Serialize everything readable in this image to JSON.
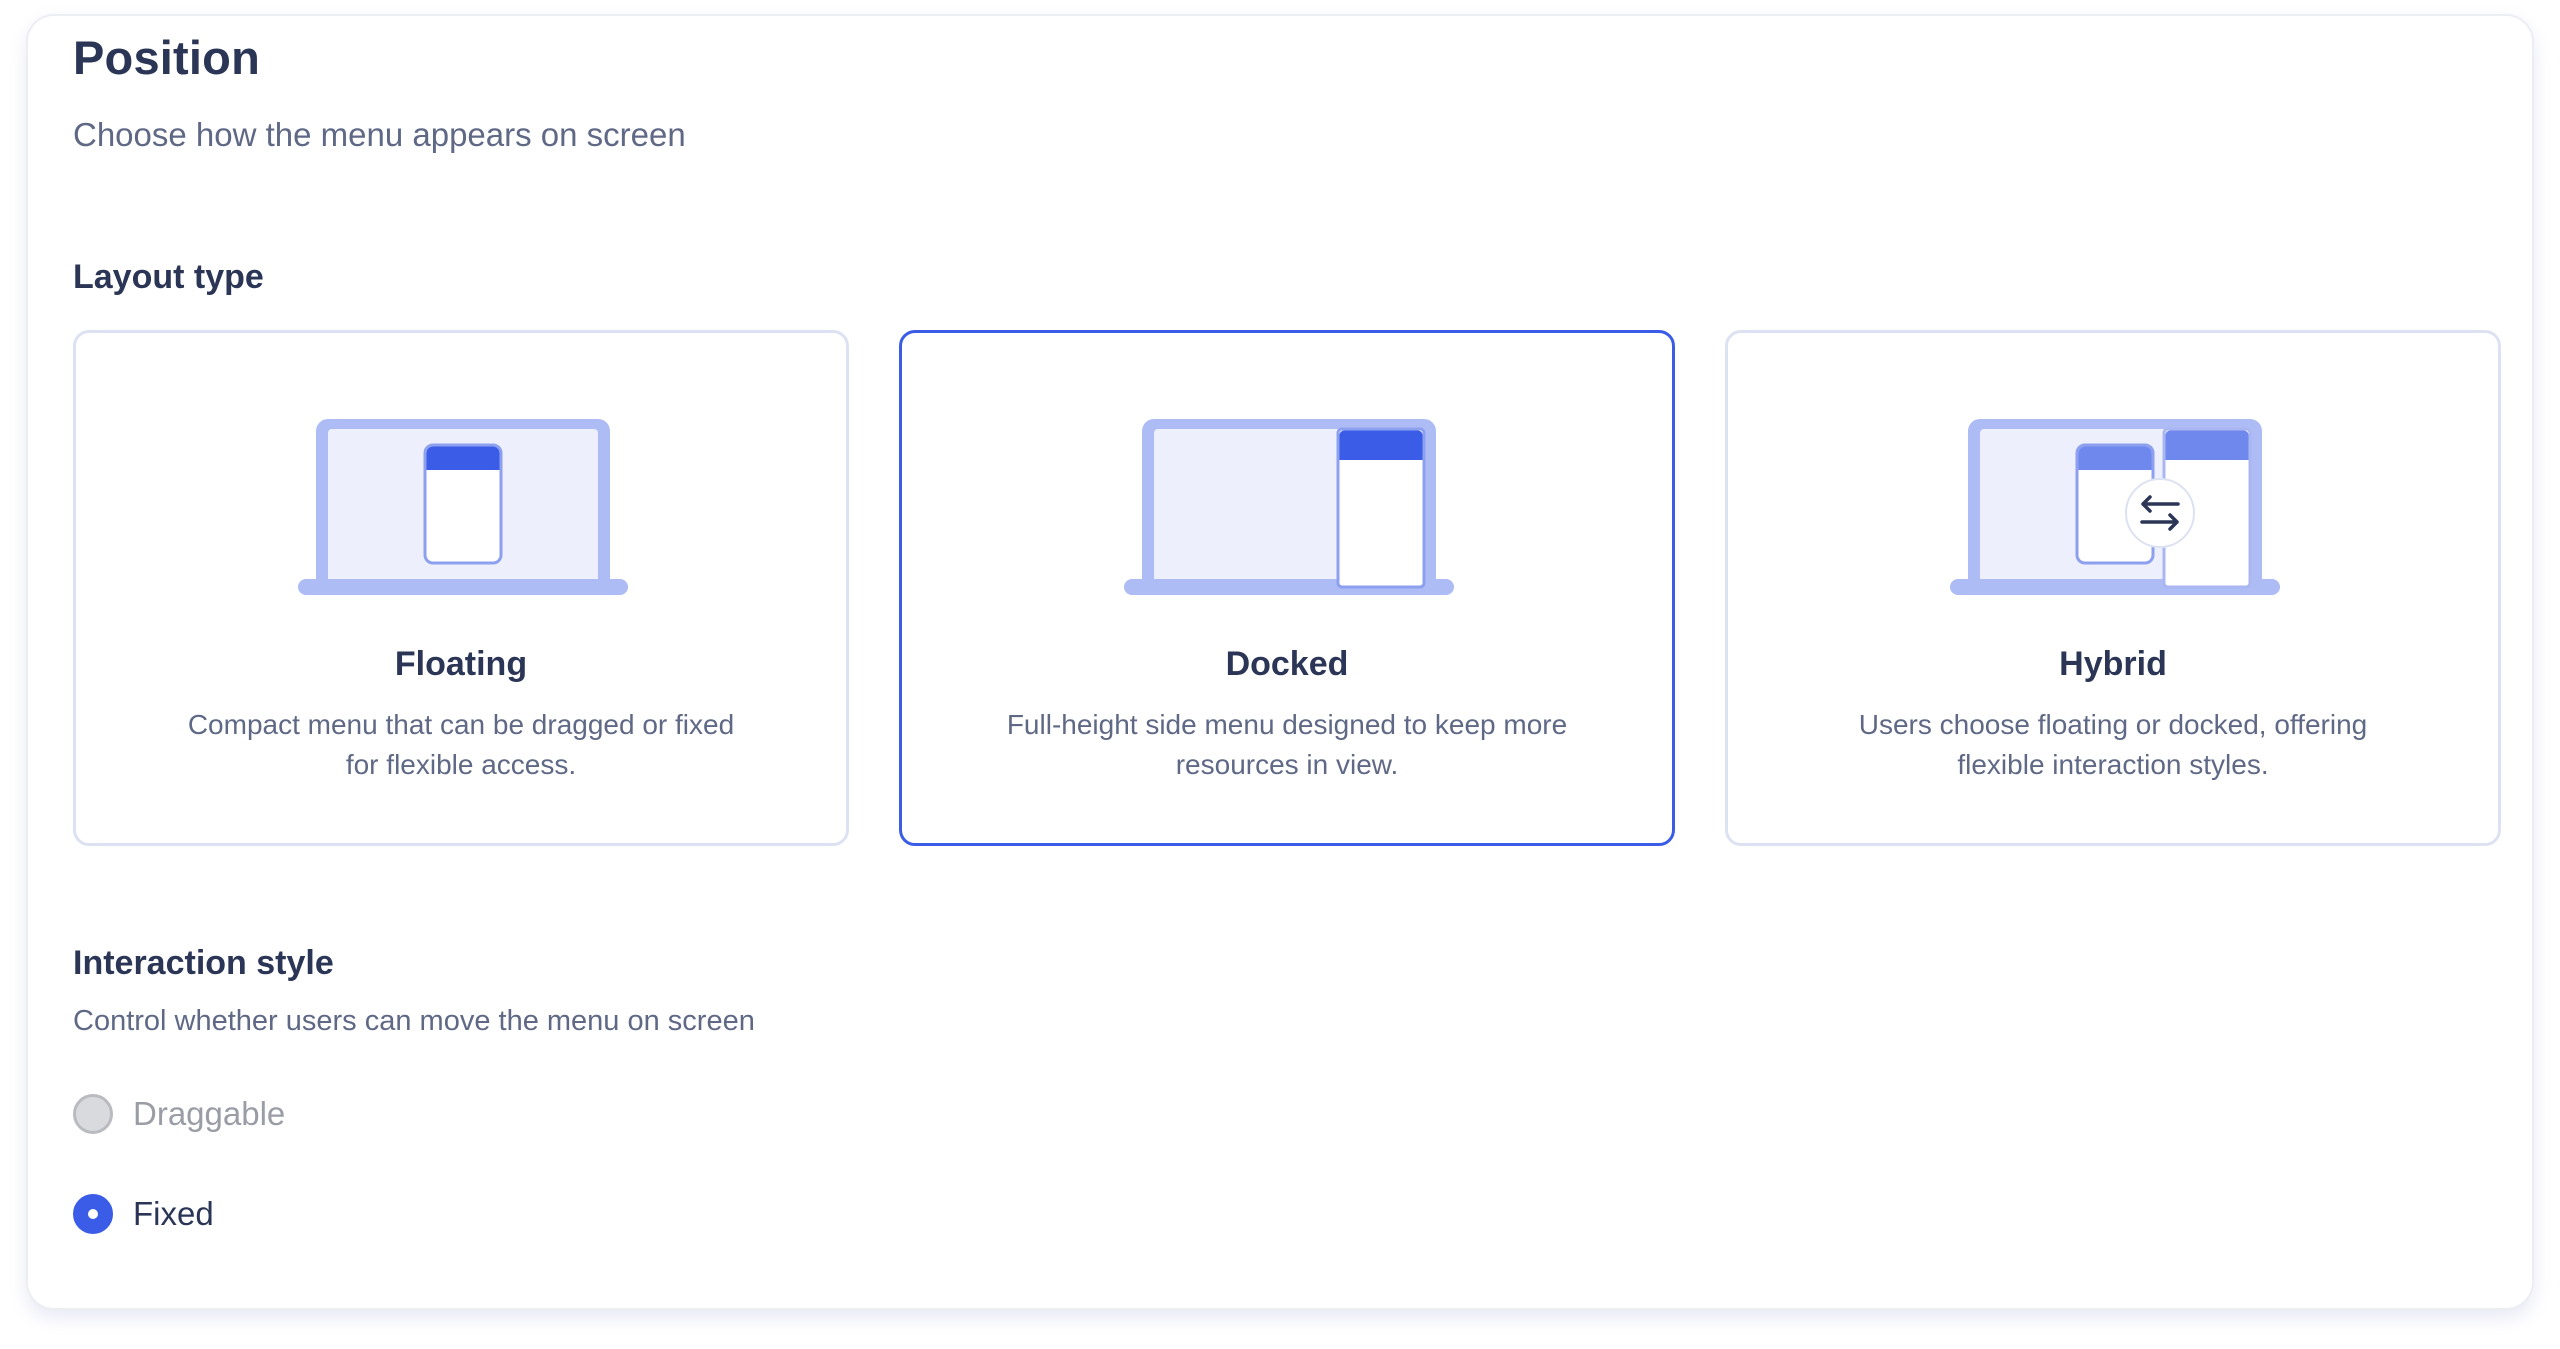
{
  "header": {
    "title": "Position",
    "subtitle": "Choose how the menu appears on screen"
  },
  "layout": {
    "label": "Layout type",
    "selected": "Docked",
    "options": [
      {
        "title": "Floating",
        "description": "Compact menu that can be dragged or fixed for flexible access.",
        "icon": "floating-layout-icon"
      },
      {
        "title": "Docked",
        "description": "Full-height side menu designed to keep more resources in view.",
        "icon": "docked-layout-icon"
      },
      {
        "title": "Hybrid",
        "description": "Users choose floating or docked, offering flexible interaction styles.",
        "icon": "hybrid-layout-icon"
      }
    ]
  },
  "interaction": {
    "label": "Interaction style",
    "description": "Control whether users can move the menu on screen",
    "selected": "Fixed",
    "options": [
      {
        "label": "Draggable",
        "disabled": true
      },
      {
        "label": "Fixed",
        "disabled": false
      }
    ]
  },
  "colors": {
    "accent": "#3a5ce6",
    "heading": "#2b3656",
    "body_text": "#5f6986",
    "card_border": "#dde2f3",
    "illustration_light": "#aebcf5",
    "illustration_fill": "#edf0fc"
  }
}
